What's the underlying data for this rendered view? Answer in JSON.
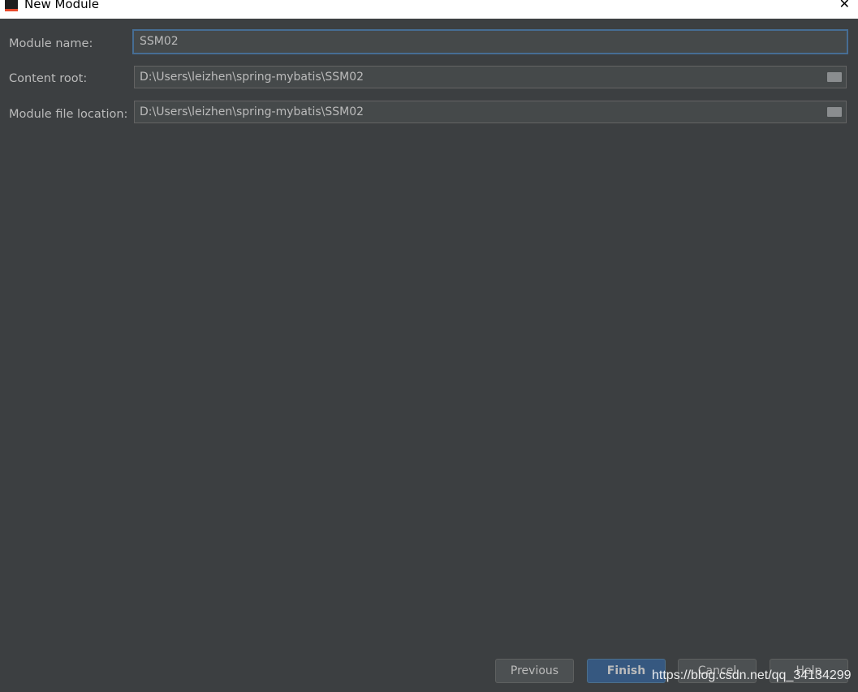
{
  "window": {
    "title": "New Module"
  },
  "form": {
    "module_name_label": "Module name:",
    "module_name": "SSM02",
    "content_root_label": "Content root:",
    "content_root": "D:\\Users\\leizhen\\spring-mybatis\\SSM02",
    "file_location_label": "Module file location:",
    "file_location": "D:\\Users\\leizhen\\spring-mybatis\\SSM02"
  },
  "buttons": {
    "previous": "Previous",
    "finish": "Finish",
    "cancel": "Cancel",
    "help": "Help"
  },
  "watermark": "https://blog.csdn.net/qq_34134299"
}
